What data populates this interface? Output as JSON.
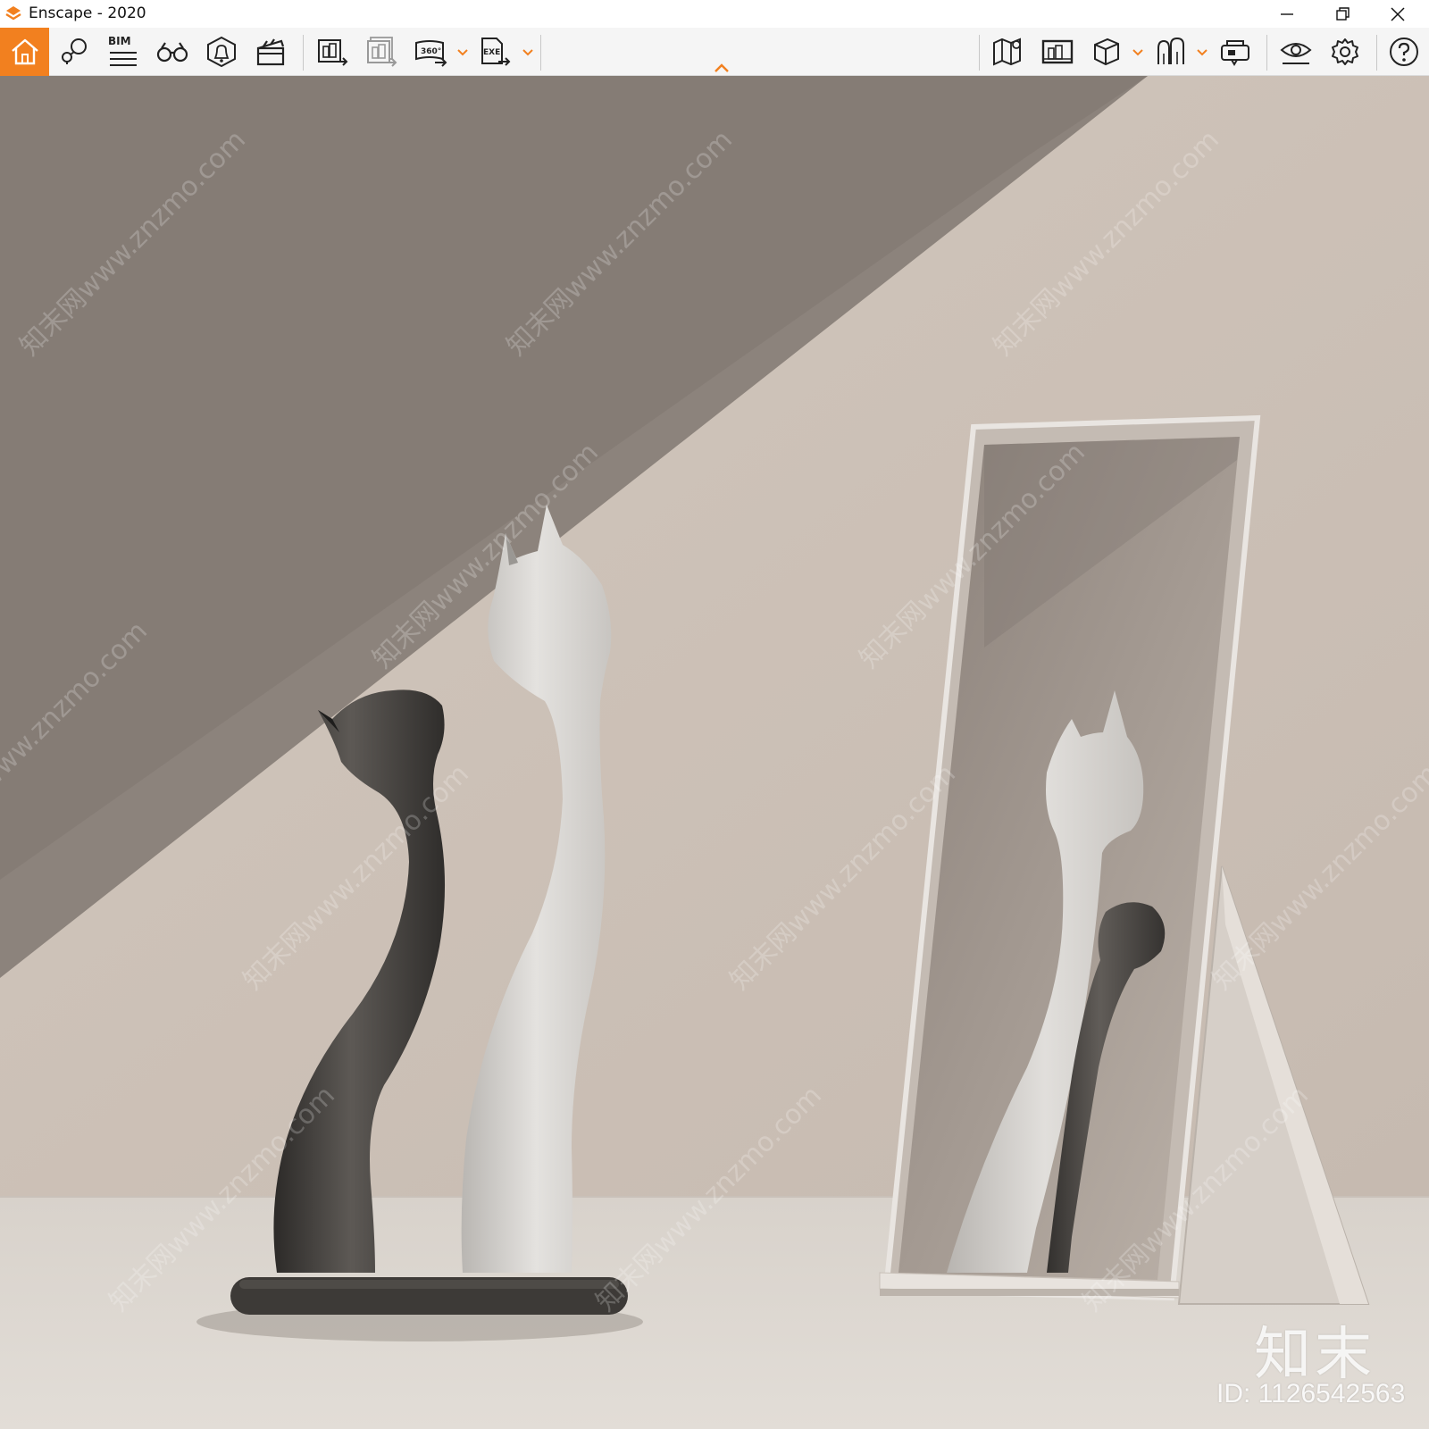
{
  "window": {
    "title": "Enscape - 2020"
  },
  "toolbar": {
    "bim_label": "BIM",
    "icons": [
      "home-icon",
      "location-pin-icon",
      "bim-icon",
      "binoculars-icon",
      "bell-warning-icon",
      "clapper-icon",
      "render-screenshot-icon",
      "batch-render-icon",
      "panorama-360-icon",
      "exe-export-icon",
      "map-icon",
      "render-history-icon",
      "cube-view-icon",
      "asset-library-icon",
      "vr-headset-icon",
      "eye-visual-settings-icon",
      "settings-gear-icon",
      "help-icon"
    ],
    "accent_color": "#f2801f",
    "panorama_label": "360°",
    "exe_label": "EXE"
  },
  "watermark": {
    "logo_text": "知末",
    "id_text": "ID: 1126542563",
    "diagonal_text": "知末网www.znzmo.com"
  }
}
